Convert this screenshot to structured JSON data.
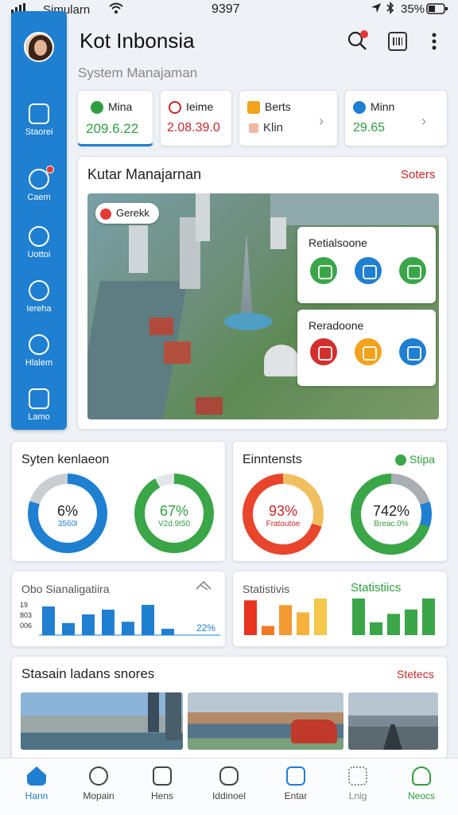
{
  "status_bar": {
    "carrier": "Simularn",
    "time": "9397",
    "battery": "35%"
  },
  "header": {
    "title": "Kot Inbonsia",
    "subtitle": "System Manajaman"
  },
  "sidebar": {
    "items": [
      {
        "label": "Staorei",
        "icon": "building-icon"
      },
      {
        "label": "Caem",
        "icon": "location-pin-icon"
      },
      {
        "label": "Uottoi",
        "icon": "power-icon"
      },
      {
        "label": "Iereha",
        "icon": "no-entry-icon"
      },
      {
        "label": "Hlalem",
        "icon": "alarm-icon"
      },
      {
        "label": "Lamo",
        "icon": "image-icon"
      }
    ]
  },
  "kpis": [
    {
      "label": "Mina",
      "value": "209.6.22",
      "value_color": "#2e9e3e",
      "icon_color": "#2e9e3e"
    },
    {
      "label": "Ieime",
      "value": "2.08.39.0",
      "value_color": "#c62828",
      "icon_color": "#c62828"
    },
    {
      "label": "Berts",
      "value": "Klin",
      "value_color": "#333333",
      "icon_color": "#f3a21b"
    },
    {
      "label": "Minn",
      "value": "29.65",
      "value_color": "#2e9e3e",
      "icon_color": "#1f7fd0"
    }
  ],
  "map_panel": {
    "title": "Kutar Manajarnan",
    "link": "Soters",
    "chip": "Gerekk",
    "overlay1_title": "Retialsoone",
    "overlay2_title": "Reradoone"
  },
  "stats1": {
    "title": "Syten kenlaeon",
    "ring1": {
      "value": "6%",
      "sub": "3560l"
    },
    "ring2": {
      "value": "67%",
      "sub": "V2d.9t50"
    }
  },
  "stats2": {
    "title": "Einntensts",
    "badge": "Stipa",
    "ring1": {
      "value": "93%",
      "sub": "Fratoutoe"
    },
    "ring2": {
      "value": "742%",
      "sub": "Breac.0%"
    }
  },
  "bar1": {
    "title": "Obo Sianaligatiira",
    "ticks": [
      "19",
      "803",
      "006"
    ],
    "note": "22%",
    "values": [
      0.9,
      0.38,
      0.65,
      0.8,
      0.42,
      0.95,
      0.2
    ]
  },
  "bar2": {
    "title_left": "Statistivis",
    "title_right": "Statistiics",
    "red_group": [
      0.95,
      0.25,
      0.82,
      0.62,
      1.0
    ],
    "green_group": [
      1.0,
      0.35,
      0.58,
      0.7,
      1.0
    ]
  },
  "stations": {
    "title": "Stasain ladans snores",
    "link": "Stetecs"
  },
  "bottom_nav": [
    {
      "label": "Hann",
      "active": true
    },
    {
      "label": "Mopain",
      "active": false
    },
    {
      "label": "Hens",
      "active": false
    },
    {
      "label": "Iddinoel",
      "active": false
    },
    {
      "label": "Entar",
      "active": false
    },
    {
      "label": "Lnig",
      "active": false
    },
    {
      "label": "Neocs",
      "active": false
    }
  ],
  "colors": {
    "primary": "#1f7fd0",
    "green": "#2e9e3e",
    "red": "#c62828",
    "orange": "#f3a21b"
  }
}
